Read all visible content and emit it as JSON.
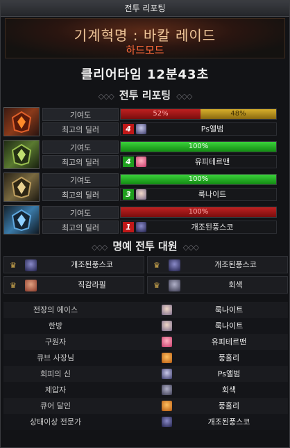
{
  "window": {
    "title": "전투 리포팅"
  },
  "banner": {
    "raid_name": "기계혁명 : 바칼 레이드",
    "mode": "하드모드"
  },
  "clear_time": "클리어타임 12분43초",
  "report_section": {
    "title": "전투 리포팅"
  },
  "honor_section": {
    "title": "명예 전투 대원"
  },
  "labels": {
    "contribution": "기여도",
    "best_dealer": "최고의 딜러"
  },
  "parties": [
    {
      "boss_icon": "bakal-fire-icon",
      "contribution": [
        {
          "value": 52,
          "label": "52%",
          "color": "red"
        },
        {
          "value": 48,
          "label": "48%",
          "color": "gold"
        }
      ],
      "rank": "4",
      "rank_color": "red",
      "dealer": "Ps앨범"
    },
    {
      "boss_icon": "bakal-green-icon",
      "contribution": [
        {
          "value": 100,
          "label": "100%",
          "color": "green"
        }
      ],
      "rank": "4",
      "rank_color": "green",
      "dealer": "유피테르맨"
    },
    {
      "boss_icon": "bakal-gold-icon",
      "contribution": [
        {
          "value": 100,
          "label": "100%",
          "color": "green"
        }
      ],
      "rank": "3",
      "rank_color": "green",
      "dealer": "룩나이트"
    },
    {
      "boss_icon": "bakal-blue-icon",
      "contribution": [
        {
          "value": 100,
          "label": "100%",
          "color": "red"
        }
      ],
      "rank": "1",
      "rank_color": "red",
      "dealer": "개조된풍스코"
    }
  ],
  "honor_members": [
    "개조된풍스코",
    "개조된풍스코",
    "직감라필",
    "회색"
  ],
  "awards": [
    {
      "title": "전장의 에이스",
      "name": "룩나이트"
    },
    {
      "title": "한방",
      "name": "룩나이트"
    },
    {
      "title": "구원자",
      "name": "유피테르맨"
    },
    {
      "title": "큐브 사장님",
      "name": "풍홀리"
    },
    {
      "title": "회피의 신",
      "name": "Ps앨범"
    },
    {
      "title": "제압자",
      "name": "회색"
    },
    {
      "title": "큐어 달인",
      "name": "풍홀리"
    },
    {
      "title": "상태이상 전문가",
      "name": "개조된풍스코"
    }
  ]
}
